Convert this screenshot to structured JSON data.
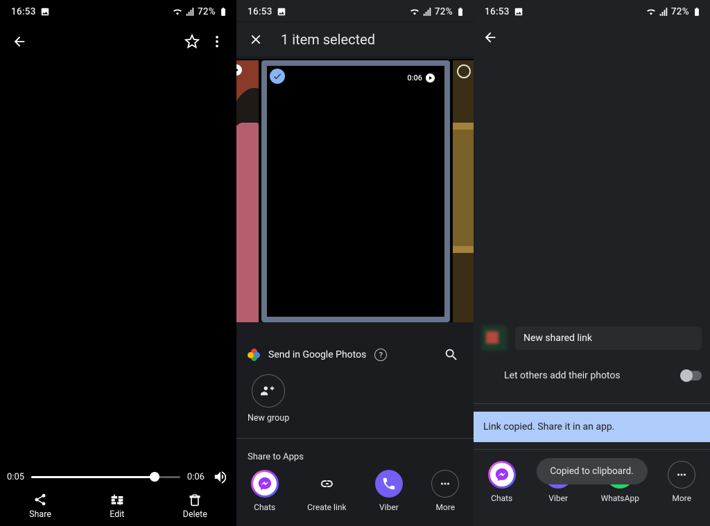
{
  "statusbar": {
    "time": "16:53",
    "battery": "72%"
  },
  "panel1": {
    "video": {
      "current": "0:05",
      "duration": "0:06"
    },
    "actions": {
      "share": "Share",
      "edit": "Edit",
      "delete": "Delete"
    }
  },
  "panel2": {
    "title": "1 item selected",
    "item_duration": "0:06",
    "send_label": "Send in Google Photos",
    "new_group": "New group",
    "shareToApps_title": "Share to Apps",
    "apps": {
      "chats": "Chats",
      "create_link": "Create link",
      "viber": "Viber",
      "more": "More"
    }
  },
  "panel3": {
    "new_shared": "New shared link",
    "let_others": "Let others add their photos",
    "banner": "Link copied. Share it in an app.",
    "toast": "Copied to clipboard.",
    "apps": {
      "chats": "Chats",
      "viber": "Viber",
      "whatsapp": "WhatsApp",
      "more": "More"
    }
  }
}
